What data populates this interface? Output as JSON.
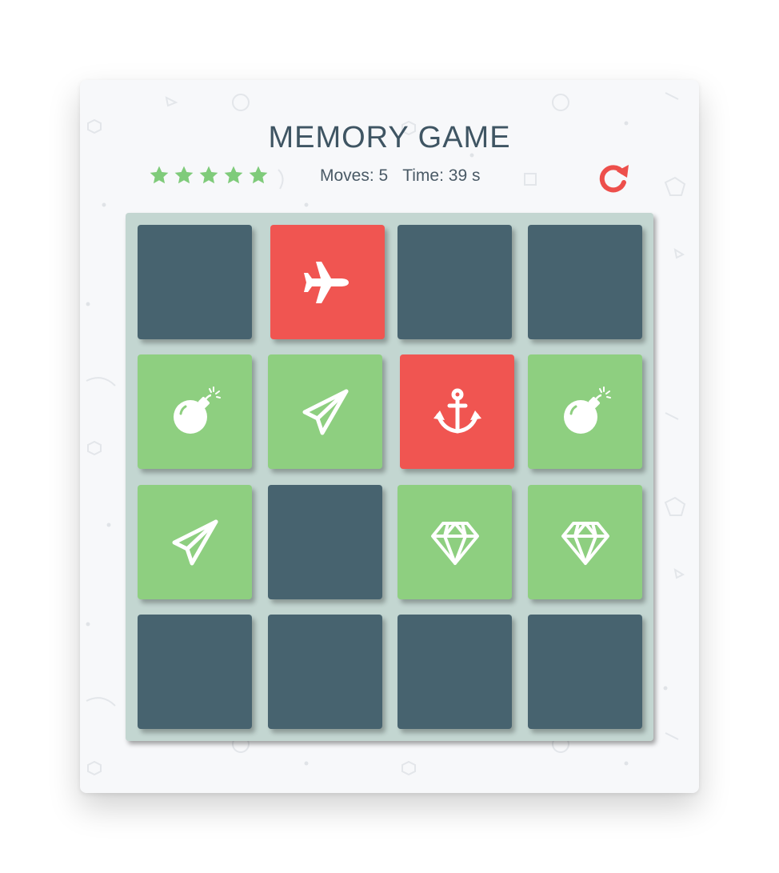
{
  "title": "MEMORY GAME",
  "score_panel": {
    "stars": [
      "star-filled",
      "star-filled",
      "star-filled",
      "star-filled",
      "star-filled"
    ],
    "moves_label": "Moves:",
    "moves": "5",
    "time_label": "Time:",
    "time": "39",
    "time_unit": "s",
    "restart_icon": "restart-icon"
  },
  "colors": {
    "hidden": "#47636f",
    "match": "#8ecf80",
    "open": "#f05551",
    "star": "#7fcb7a",
    "restart": "#ed4f4b",
    "deck": "#c3d6d1"
  },
  "deck": {
    "rows": 4,
    "cols": 4,
    "cards": [
      {
        "state": "hidden",
        "icon": ""
      },
      {
        "state": "open",
        "icon": "plane"
      },
      {
        "state": "hidden",
        "icon": ""
      },
      {
        "state": "hidden",
        "icon": ""
      },
      {
        "state": "match",
        "icon": "bomb"
      },
      {
        "state": "match",
        "icon": "paper-plane"
      },
      {
        "state": "open",
        "icon": "anchor"
      },
      {
        "state": "match",
        "icon": "bomb"
      },
      {
        "state": "match",
        "icon": "paper-plane"
      },
      {
        "state": "hidden",
        "icon": ""
      },
      {
        "state": "match",
        "icon": "diamond"
      },
      {
        "state": "match",
        "icon": "diamond"
      },
      {
        "state": "hidden",
        "icon": ""
      },
      {
        "state": "hidden",
        "icon": ""
      },
      {
        "state": "hidden",
        "icon": ""
      },
      {
        "state": "hidden",
        "icon": ""
      }
    ]
  }
}
